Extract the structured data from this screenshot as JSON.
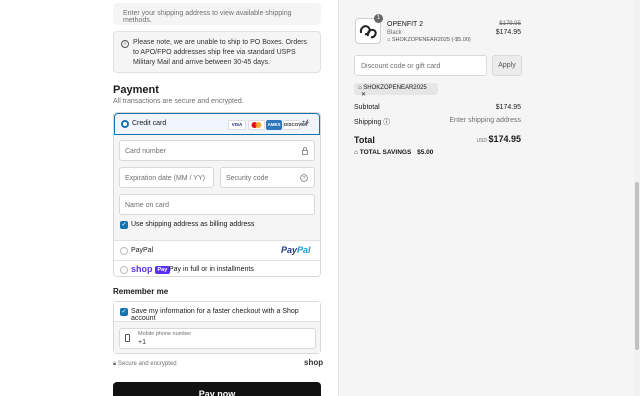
{
  "shipping_method_notice": "Enter your shipping address to view available shipping methods.",
  "po_box_notice": "Please note, we are unable to ship to PO Boxes. Orders to APO/FPO addresses ship free via standard USPS Military Mail and arrive between 30-45 days.",
  "payment": {
    "title": "Payment",
    "subtitle": "All transactions are secure and encrypted.",
    "credit_card_label": "Credit card",
    "card_brands": [
      "VISA",
      "MC",
      "AMEX",
      "DISCOVER"
    ],
    "more_cards": "+4",
    "card_number_placeholder": "Card number",
    "expiration_placeholder": "Expiration date (MM / YY)",
    "security_code_placeholder": "Security code",
    "name_on_card_placeholder": "Name on card",
    "billing_checkbox_label": "Use shipping address as billing address",
    "paypal_label": "PayPal",
    "paypal_logo_pay": "Pay",
    "paypal_logo_pal": "Pal",
    "shop_pay_logo": "shop",
    "shop_pay_badge": "Pay",
    "shop_pay_label": "Pay in full or in installments"
  },
  "remember": {
    "title": "Remember me",
    "checkbox_label": "Save my information for a faster checkout with a Shop account",
    "phone_label": "Mobile phone number",
    "phone_prefix": "+1",
    "secure_text": "Secure and encrypted",
    "shop_logo": "shop"
  },
  "pay_now_label": "Pay now",
  "order": {
    "quantity": "1",
    "product_name": "OPENFIT 2",
    "variant": "Black",
    "discount_line": "SHOKZOPENEAR2025 (-$5.00)",
    "original_price": "$179.95",
    "price": "$174.95",
    "discount_placeholder": "Discount code or gift card",
    "apply_label": "Apply",
    "applied_code": "SHOKZOPENEAR2025",
    "subtotal_label": "Subtotal",
    "subtotal_value": "$174.95",
    "shipping_label": "Shipping",
    "shipping_value": "Enter shipping address",
    "total_label": "Total",
    "currency": "USD",
    "total_value": "$174.95",
    "savings_label": "TOTAL SAVINGS",
    "savings_value": "$5.00"
  },
  "colors": {
    "accent": "#1773b0",
    "button_dark": "#111111",
    "shop_purple": "#5a31f4",
    "sidebar_bg": "#f5f5f5"
  }
}
